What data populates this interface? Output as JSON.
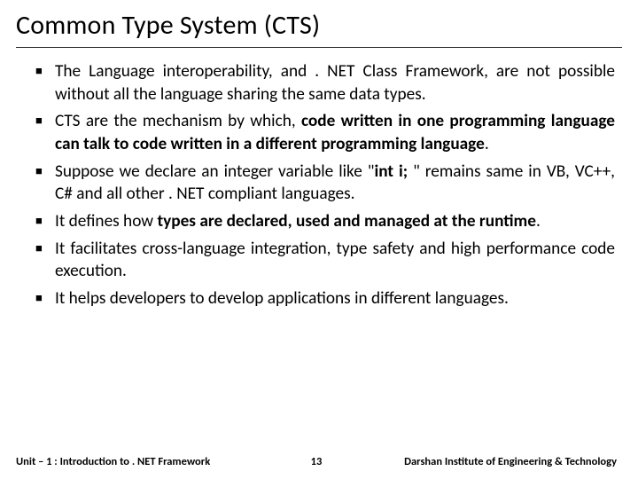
{
  "slide": {
    "title": "Common Type System (CTS)",
    "bullets": [
      {
        "pre": "The Language interoperability, and . NET Class Framework, are not possible without all the language sharing the same data types.",
        "bold": "",
        "post": ""
      },
      {
        "pre": "CTS are the mechanism by which, ",
        "bold": "code written in one programming language can talk to code written in a different programming language",
        "post": "."
      },
      {
        "pre": "Suppose we declare an integer variable like \"",
        "bold": "int i; ",
        "post": "\" remains same in VB, VC++, C# and all other . NET compliant languages."
      },
      {
        "pre": "It defines how ",
        "bold": "types are declared, used and managed at the runtime",
        "post": "."
      },
      {
        "pre": "It facilitates cross-language integration, type safety and high performance code execution.",
        "bold": "",
        "post": ""
      },
      {
        "pre": "It helps developers to develop applications in different languages.",
        "bold": "",
        "post": ""
      }
    ]
  },
  "footer": {
    "left": "Unit – 1 : Introduction to . NET Framework",
    "center": "13",
    "right": "Darshan Institute of Engineering & Technology"
  }
}
